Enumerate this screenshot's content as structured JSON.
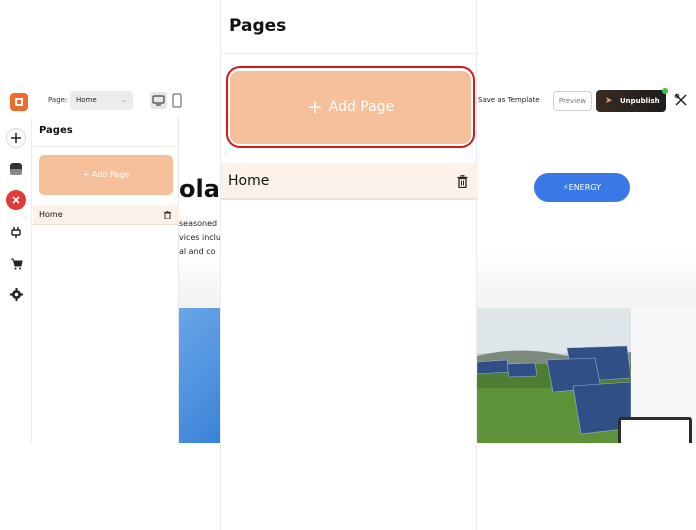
{
  "editor": {
    "page_label": "Page:",
    "page_select_value": "Home",
    "save_template_label": "Save as Template",
    "preview_label": "Preview",
    "unpublish_label": "Unpublish"
  },
  "pages_panel": {
    "title": "Pages",
    "add_page_label": "+ Add Page",
    "pages": [
      {
        "name": "Home"
      }
    ]
  },
  "canvas": {
    "hero_fragment": "olar?",
    "text_lines": [
      "seasoned",
      "vices inclu",
      "al and co"
    ],
    "energy_button": "⚡ENERGY"
  },
  "overlay": {
    "title": "Pages",
    "add_page_plus": "+",
    "add_page_label": "Add Page",
    "home_page": "Home"
  },
  "colors": {
    "accent_peach": "#f5c09a",
    "highlight_red": "#d11a1a",
    "energy_blue": "#3b78e7",
    "rail_red": "#e23b3b"
  }
}
